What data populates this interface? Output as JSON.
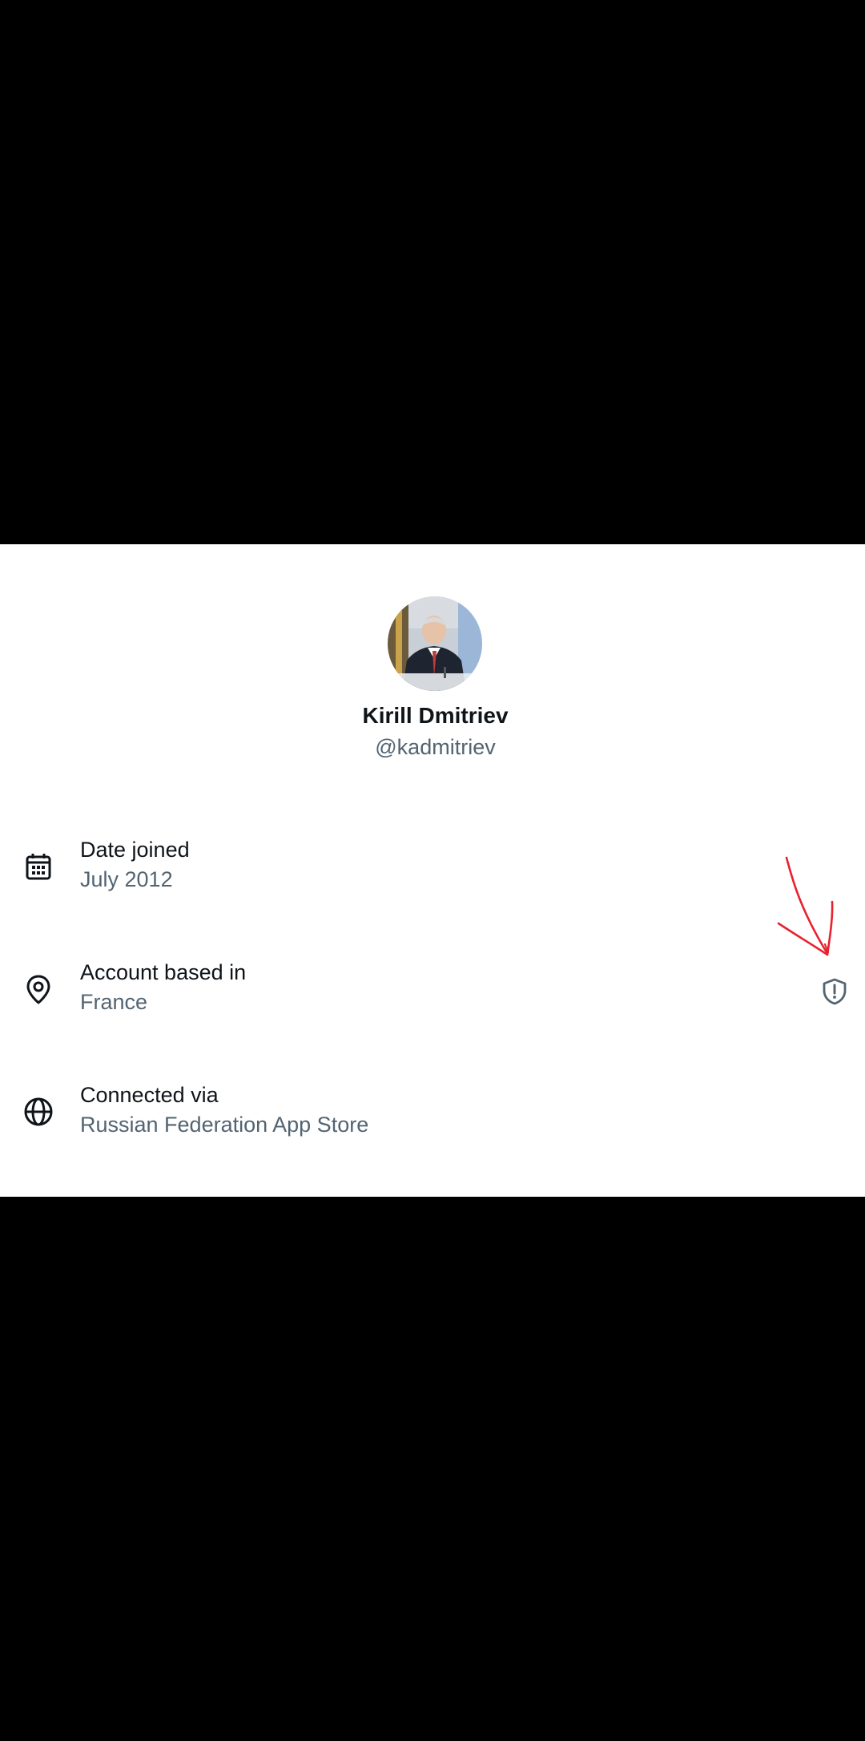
{
  "profile": {
    "display_name": "Kirill Dmitriev",
    "handle": "@kadmitriev"
  },
  "about": {
    "rows": [
      {
        "icon": "calendar-icon",
        "label": "Date joined",
        "value": "July 2012"
      },
      {
        "icon": "location-pin-icon",
        "label": "Account based in",
        "value": "France",
        "trailing_icon": "shield-alert-icon"
      },
      {
        "icon": "globe-icon",
        "label": "Connected via",
        "value": "Russian Federation App Store"
      }
    ]
  },
  "colors": {
    "primary_text": "#0f1419",
    "secondary_text": "#536471",
    "annotation_red": "#e8222e",
    "background": "#ffffff",
    "letterbox": "#000000"
  }
}
